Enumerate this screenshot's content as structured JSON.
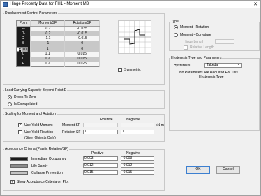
{
  "title": "Hinge Property Data for FH1 - Moment M3",
  "close_glyph": "✕",
  "displacement": {
    "group_label": "Displacement Control Parameters",
    "columns": [
      "Point",
      "Moment/SF",
      "Rotation/SF"
    ],
    "rows": [
      {
        "point": "E-",
        "moment": "-0.2",
        "rotation": "-0.025"
      },
      {
        "point": "D-",
        "moment": "-0.2",
        "rotation": "-0.015"
      },
      {
        "point": "C-",
        "moment": "-1.1",
        "rotation": "-0.015"
      },
      {
        "point": "B-",
        "moment": "-1",
        "rotation": "0"
      },
      {
        "point": "A",
        "moment": "0",
        "rotation": "0"
      },
      {
        "point": "B",
        "moment": "1",
        "rotation": "0"
      },
      {
        "point": "C",
        "moment": "1.1",
        "rotation": "0.015"
      },
      {
        "point": "D",
        "moment": "0.2",
        "rotation": "0.015"
      },
      {
        "point": "E",
        "moment": "0.2",
        "rotation": "0.025"
      }
    ],
    "symmetric_label": "Symmetric"
  },
  "type_group": {
    "label": "Type",
    "moment_rotation": "Moment - Rotation",
    "moment_curvature": "Moment - Curvature",
    "hinge_length": "Hinge Length",
    "relative_length": "Relative Length"
  },
  "hysteresis": {
    "label": "Hysteresis Type and Parameters",
    "field_label": "Hysteresis",
    "value": "Takeda",
    "dropdown_glyph": "⌄",
    "note_line1": "No Parameters Are Required For This",
    "note_line2": "Hysteresis Type"
  },
  "load_capacity": {
    "label": "Load Carrying Capacity Beyond Point E",
    "drops": "Drops To Zero",
    "extrapolated": "Is Extrapolated"
  },
  "scaling": {
    "label": "Scaling for Moment and Rotation",
    "positive": "Positive",
    "negative": "Negative",
    "use_yield_moment": "Use Yield Moment",
    "moment_sf": "Moment SF",
    "units": "kN-m",
    "use_yield_rotation": "Use Yield Rotation",
    "rotation_sf": "Rotation SF",
    "steel_only": "(Steel Objects Only)",
    "rotation_pos": "1",
    "rotation_neg": "1"
  },
  "acceptance": {
    "label": "Acceptance Criteria (Plastic Rotation/SF)",
    "positive": "Positive",
    "negative": "Negative",
    "rows": [
      {
        "name": "Immediate Occupancy",
        "pos": "0.003",
        "neg": "-0.003",
        "color": "#1c1c1c"
      },
      {
        "name": "Life Safety",
        "pos": "0.012",
        "neg": "-0.012",
        "color": "#8c8c8c"
      },
      {
        "name": "Collapse Prevention",
        "pos": "0.015",
        "neg": "-0.015",
        "color": "#c4c4c4"
      }
    ],
    "show_label": "Show Acceptance Criteria on Plot"
  },
  "buttons": {
    "ok": "OK",
    "cancel": "Cancel"
  },
  "check_mark": "✓"
}
